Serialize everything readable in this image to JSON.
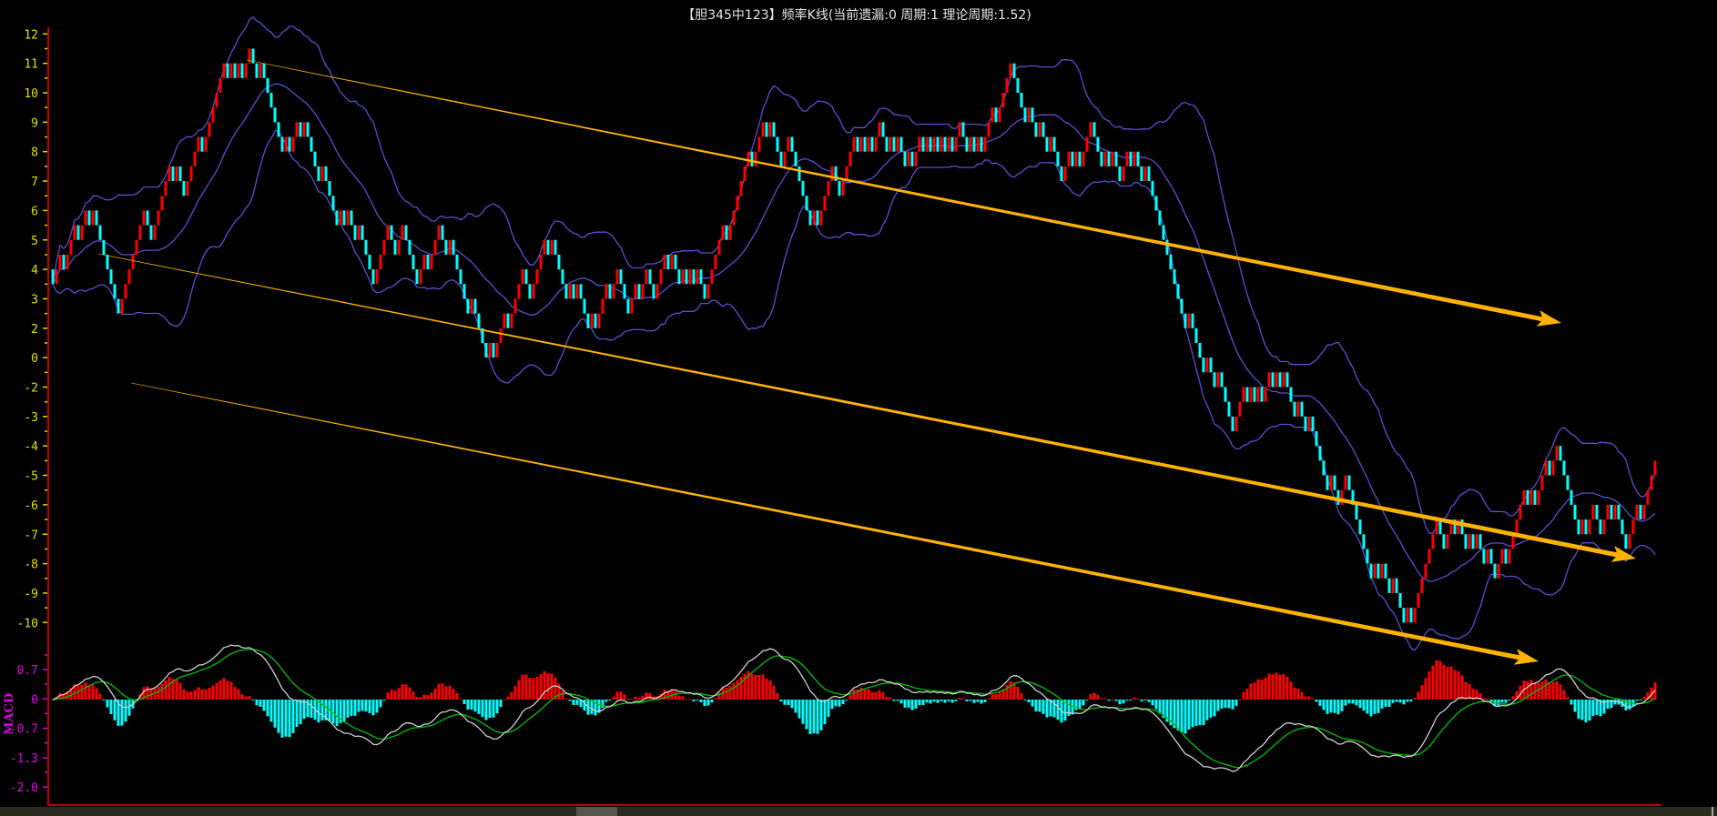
{
  "header": {
    "title": "【胆345中123】频率K线(当前遗漏:0 周期:1 理论周期:1.52)"
  },
  "colors": {
    "up": "#ff0000",
    "down": "#00ffff",
    "band": "#5a4fd0",
    "axis": "#c00000",
    "arrow": "#ffb300",
    "dif": "#d0d0d0",
    "dea": "#00c000",
    "price_label": "#e0e000",
    "macd_label": "#e000e0"
  },
  "chart_data": [
    {
      "type": "candlestick",
      "title": "【胆345中123】频率K线(当前遗漏:0 周期:1 理论周期:1.52)",
      "y_tick_labels": [
        "12",
        "11",
        "10",
        "9",
        "8",
        "7",
        "6",
        "5",
        "4",
        "3",
        "2",
        "0",
        "-2",
        "-3",
        "-4",
        "-5",
        "-6",
        "-7",
        "-8",
        "-9",
        "-10"
      ],
      "ylim_position": [
        -8,
        12
      ],
      "candle_count": 441,
      "step": 0.5,
      "close_path_waypoints": [
        [
          0,
          4.2
        ],
        [
          7,
          6.3
        ],
        [
          11,
          6.3
        ],
        [
          14,
          3.9
        ],
        [
          17,
          3.1
        ],
        [
          29,
          7.8
        ],
        [
          34,
          7.0
        ],
        [
          46,
          10.9
        ],
        [
          49,
          10.2
        ],
        [
          54,
          10.9
        ],
        [
          58,
          9.6
        ],
        [
          62,
          7.9
        ],
        [
          71,
          8.5
        ],
        [
          76,
          6.3
        ],
        [
          87,
          3.7
        ],
        [
          91,
          5.2
        ],
        [
          97,
          5.7
        ],
        [
          100,
          4.2
        ],
        [
          106,
          5.2
        ],
        [
          111,
          3.1
        ],
        [
          121,
          1.3
        ],
        [
          127,
          3.1
        ],
        [
          136,
          5.0
        ],
        [
          139,
          3.1
        ],
        [
          148,
          2.6
        ],
        [
          154,
          3.1
        ],
        [
          157,
          2.4
        ],
        [
          168,
          4.2
        ],
        [
          172,
          2.2
        ],
        [
          184,
          5.5
        ],
        [
          195,
          8.5
        ],
        [
          202,
          7.8
        ],
        [
          210,
          5.7
        ],
        [
          217,
          8.1
        ],
        [
          229,
          9.2
        ],
        [
          235,
          7.8
        ],
        [
          244,
          8.7
        ],
        [
          250,
          7.4
        ],
        [
          262,
          10.6
        ],
        [
          270,
          8.3
        ],
        [
          279,
          7.2
        ],
        [
          286,
          8.8
        ],
        [
          290,
          7.0
        ],
        [
          294,
          7.6
        ],
        [
          297,
          6.6
        ],
        [
          312,
          -2.1
        ],
        [
          315,
          -2.3
        ],
        [
          323,
          -0.6
        ],
        [
          335,
          0.3
        ],
        [
          344,
          -3.2
        ],
        [
          350,
          -2.8
        ],
        [
          357,
          -4.7
        ],
        [
          371,
          -8.0
        ],
        [
          380,
          -4.7
        ],
        [
          389,
          -5.4
        ],
        [
          395,
          -6.2
        ],
        [
          402,
          -4.7
        ],
        [
          413,
          -2.6
        ],
        [
          419,
          -4.7
        ],
        [
          425,
          -4.3
        ],
        [
          431,
          -4.7
        ],
        [
          437,
          -4.1
        ],
        [
          438,
          -5.4
        ],
        [
          440,
          -5.8
        ]
      ],
      "overlays": [
        "Bollinger(20,2)"
      ],
      "trend_arrows": 3
    },
    {
      "type": "line",
      "name": "MACD",
      "y_tick_labels": [
        "0.7",
        "0",
        "-0.7",
        "-1.3",
        "-2.0"
      ],
      "series": [
        {
          "name": "DIF"
        },
        {
          "name": "DEA"
        },
        {
          "name": "MACD histogram"
        }
      ],
      "params": [
        12,
        26,
        9
      ]
    }
  ],
  "macd_panel": {
    "label": "MACD"
  }
}
